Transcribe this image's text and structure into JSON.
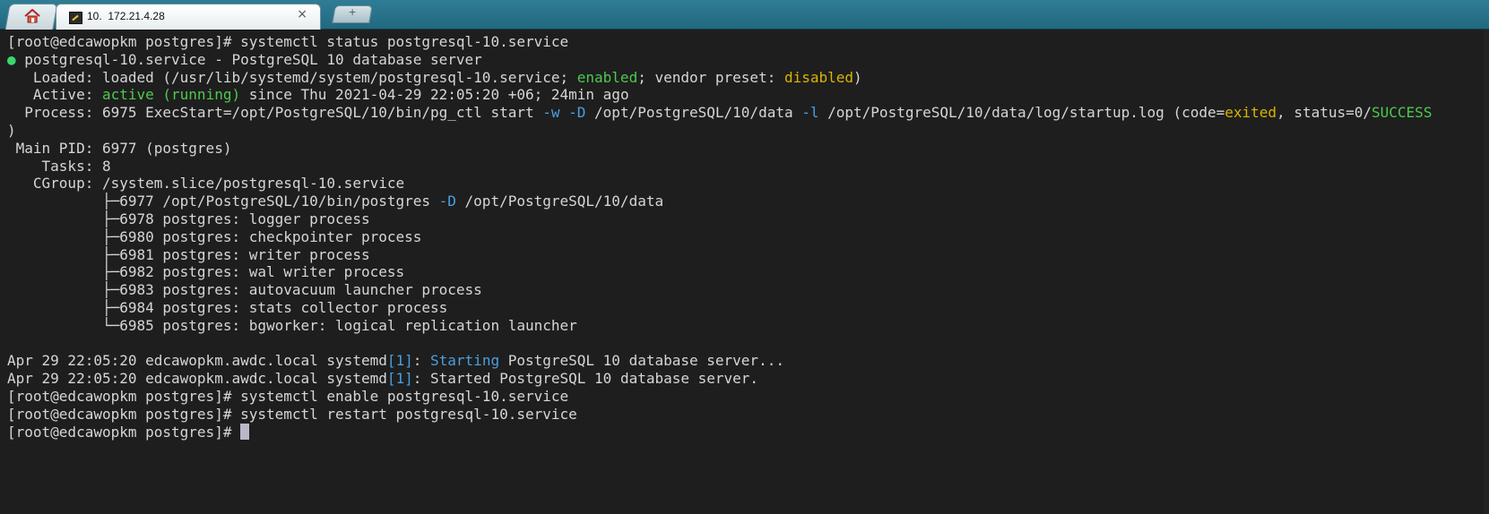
{
  "tabs": {
    "home_icon": "home-icon",
    "active_tab_title": "10.  172.21.4.28",
    "close_symbol": "×",
    "new_tab_symbol": "+"
  },
  "terminal": {
    "lines": [
      [
        {
          "t": "[root@edcawopkm postgres]# systemctl status postgresql-10.service"
        }
      ],
      [
        {
          "t": "● ",
          "c": "bright-green"
        },
        {
          "t": "postgresql-10.service - PostgreSQL 10 database server"
        }
      ],
      [
        {
          "t": "   Loaded: loaded (/usr/lib/systemd/system/postgresql-10.service; "
        },
        {
          "t": "enabled",
          "c": "green"
        },
        {
          "t": "; vendor preset: "
        },
        {
          "t": "disabled",
          "c": "yellow"
        },
        {
          "t": ")"
        }
      ],
      [
        {
          "t": "   Active: "
        },
        {
          "t": "active (running)",
          "c": "green"
        },
        {
          "t": " since Thu 2021-04-29 22:05:20 +06; 24min ago"
        }
      ],
      [
        {
          "t": "  Process: 6975 ExecStart=/opt/PostgreSQL/10/bin/pg_ctl start "
        },
        {
          "t": "-w -D",
          "c": "blue"
        },
        {
          "t": " /opt/PostgreSQL/10/data "
        },
        {
          "t": "-l",
          "c": "blue"
        },
        {
          "t": " /opt/PostgreSQL/10/data/log/startup.log (code="
        },
        {
          "t": "exited",
          "c": "yellow"
        },
        {
          "t": ", status=0/"
        },
        {
          "t": "SUCCESS",
          "c": "green"
        }
      ],
      [
        {
          "t": ")"
        }
      ],
      [
        {
          "t": " Main PID: 6977 (postgres)"
        }
      ],
      [
        {
          "t": "    Tasks: 8"
        }
      ],
      [
        {
          "t": "   CGroup: /system.slice/postgresql-10.service"
        }
      ],
      [
        {
          "t": "           ├─6977 /opt/PostgreSQL/10/bin/postgres "
        },
        {
          "t": "-D",
          "c": "blue"
        },
        {
          "t": " /opt/PostgreSQL/10/data"
        }
      ],
      [
        {
          "t": "           ├─6978 postgres: logger process"
        }
      ],
      [
        {
          "t": "           ├─6980 postgres: checkpointer process"
        }
      ],
      [
        {
          "t": "           ├─6981 postgres: writer process"
        }
      ],
      [
        {
          "t": "           ├─6982 postgres: wal writer process"
        }
      ],
      [
        {
          "t": "           ├─6983 postgres: autovacuum launcher process"
        }
      ],
      [
        {
          "t": "           ├─6984 postgres: stats collector process"
        }
      ],
      [
        {
          "t": "           └─6985 postgres: bgworker: logical replication launcher"
        }
      ],
      [
        {
          "t": ""
        }
      ],
      [
        {
          "t": "Apr 29 22:05:20 edcawopkm.awdc.local systemd"
        },
        {
          "t": "[1]",
          "c": "blue"
        },
        {
          "t": ": "
        },
        {
          "t": "Starting",
          "c": "blue"
        },
        {
          "t": " PostgreSQL 10 database server..."
        }
      ],
      [
        {
          "t": "Apr 29 22:05:20 edcawopkm.awdc.local systemd"
        },
        {
          "t": "[1]",
          "c": "blue"
        },
        {
          "t": ": Started PostgreSQL 10 database server."
        }
      ],
      [
        {
          "t": "[root@edcawopkm postgres]# systemctl enable postgresql-10.service"
        }
      ],
      [
        {
          "t": "[root@edcawopkm postgres]# systemctl restart postgresql-10.service"
        }
      ],
      [
        {
          "t": "[root@edcawopkm postgres]# "
        }
      ]
    ]
  }
}
